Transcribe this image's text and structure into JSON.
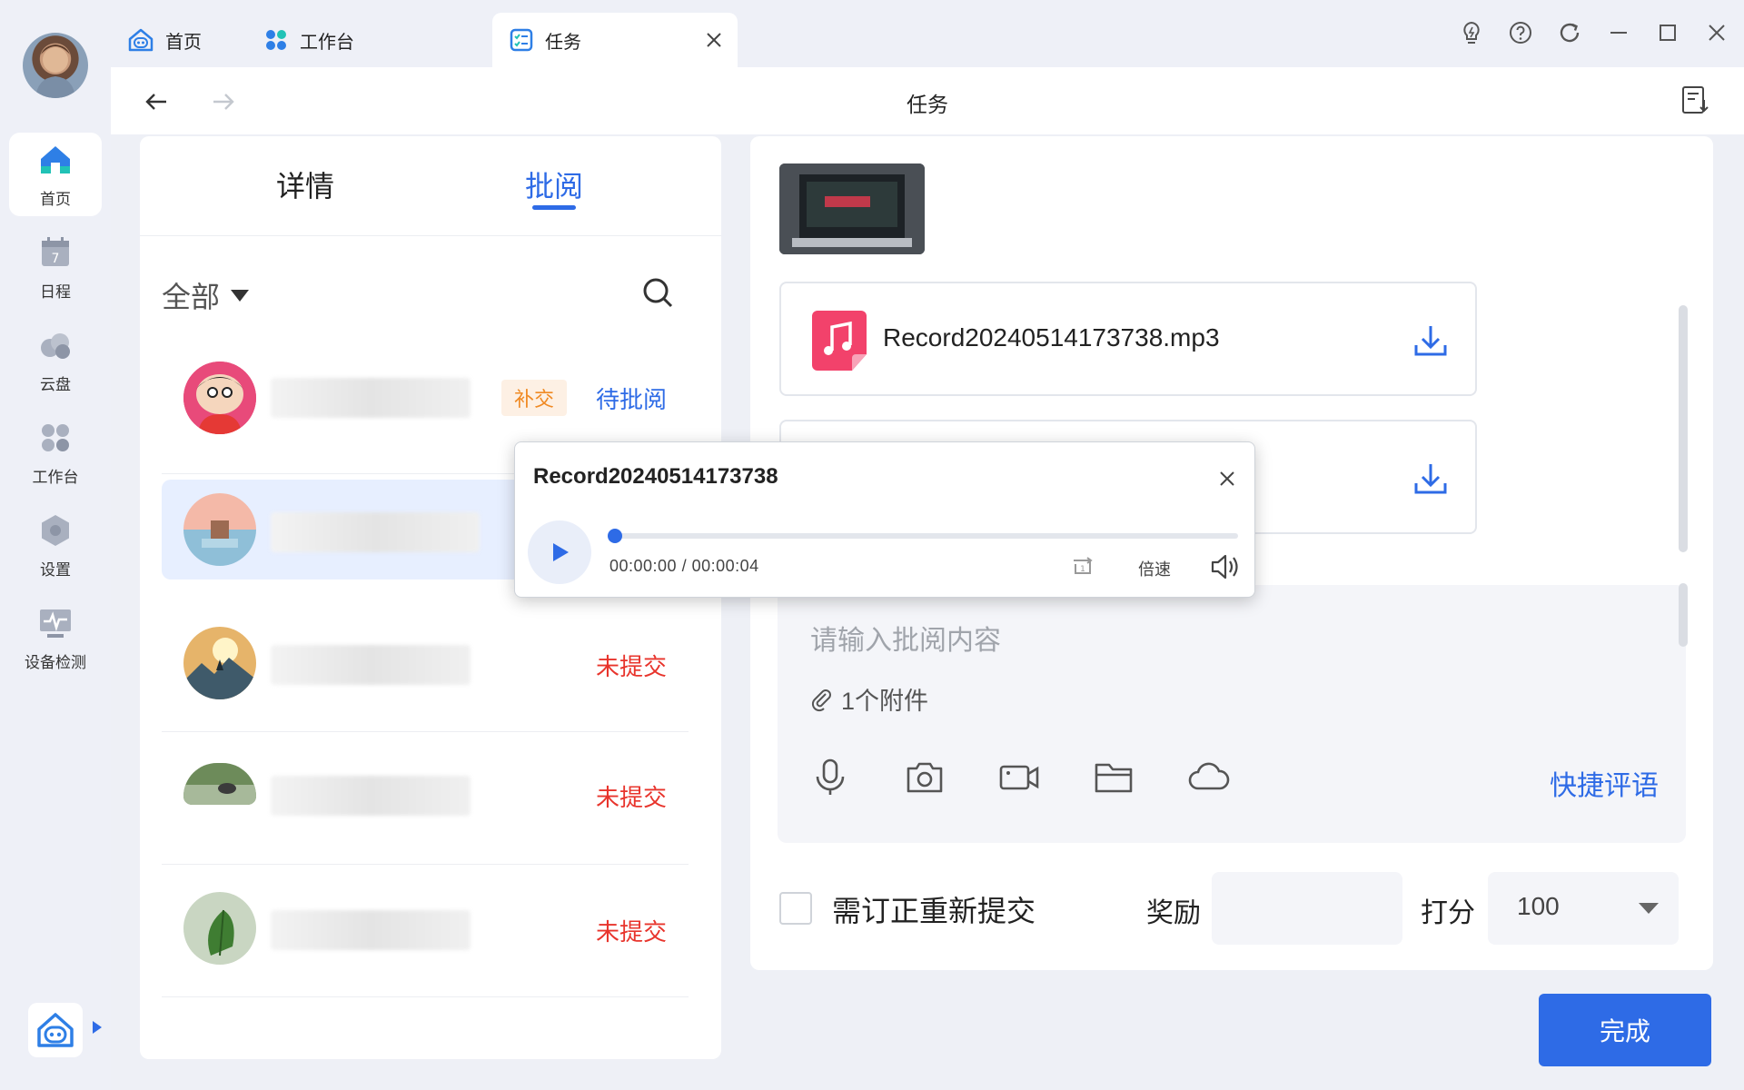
{
  "tabs": [
    {
      "label": "首页"
    },
    {
      "label": "工作台"
    },
    {
      "label": "任务"
    }
  ],
  "sidebar": {
    "items": [
      {
        "label": "首页",
        "icon": "home-icon"
      },
      {
        "label": "日程",
        "icon": "calendar-icon",
        "day": "7"
      },
      {
        "label": "云盘",
        "icon": "cloud-disk-icon"
      },
      {
        "label": "工作台",
        "icon": "workbench-icon"
      },
      {
        "label": "设置",
        "icon": "settings-icon"
      },
      {
        "label": "设备检测",
        "icon": "device-check-icon"
      }
    ]
  },
  "header": {
    "title": "任务"
  },
  "left_panel": {
    "tabs": [
      "详情",
      "批阅"
    ],
    "filter_label": "全部",
    "rows": [
      {
        "badge": "补交",
        "status": "待批阅"
      },
      {
        "status": ""
      },
      {
        "status": "未提交"
      },
      {
        "status": "未提交"
      },
      {
        "status": "未提交"
      }
    ]
  },
  "right_panel": {
    "files": [
      {
        "name": "Record20240514173738.mp3"
      },
      {
        "name": ""
      }
    ],
    "review_placeholder": "请输入批阅内容",
    "attachments": "1个附件",
    "quick_comments": "快捷评语",
    "resubmit_label": "需订正重新提交",
    "reward_label": "奖励",
    "score_label": "打分",
    "score_value": "100"
  },
  "done_button": "完成",
  "audio_popup": {
    "title": "Record20240514173738",
    "time": "00:00:00 / 00:00:04",
    "speed_label": "倍速",
    "progress": 0
  },
  "colors": {
    "accent": "#2e6be6",
    "missing": "#e8342c",
    "makeup": "#f08a24"
  }
}
